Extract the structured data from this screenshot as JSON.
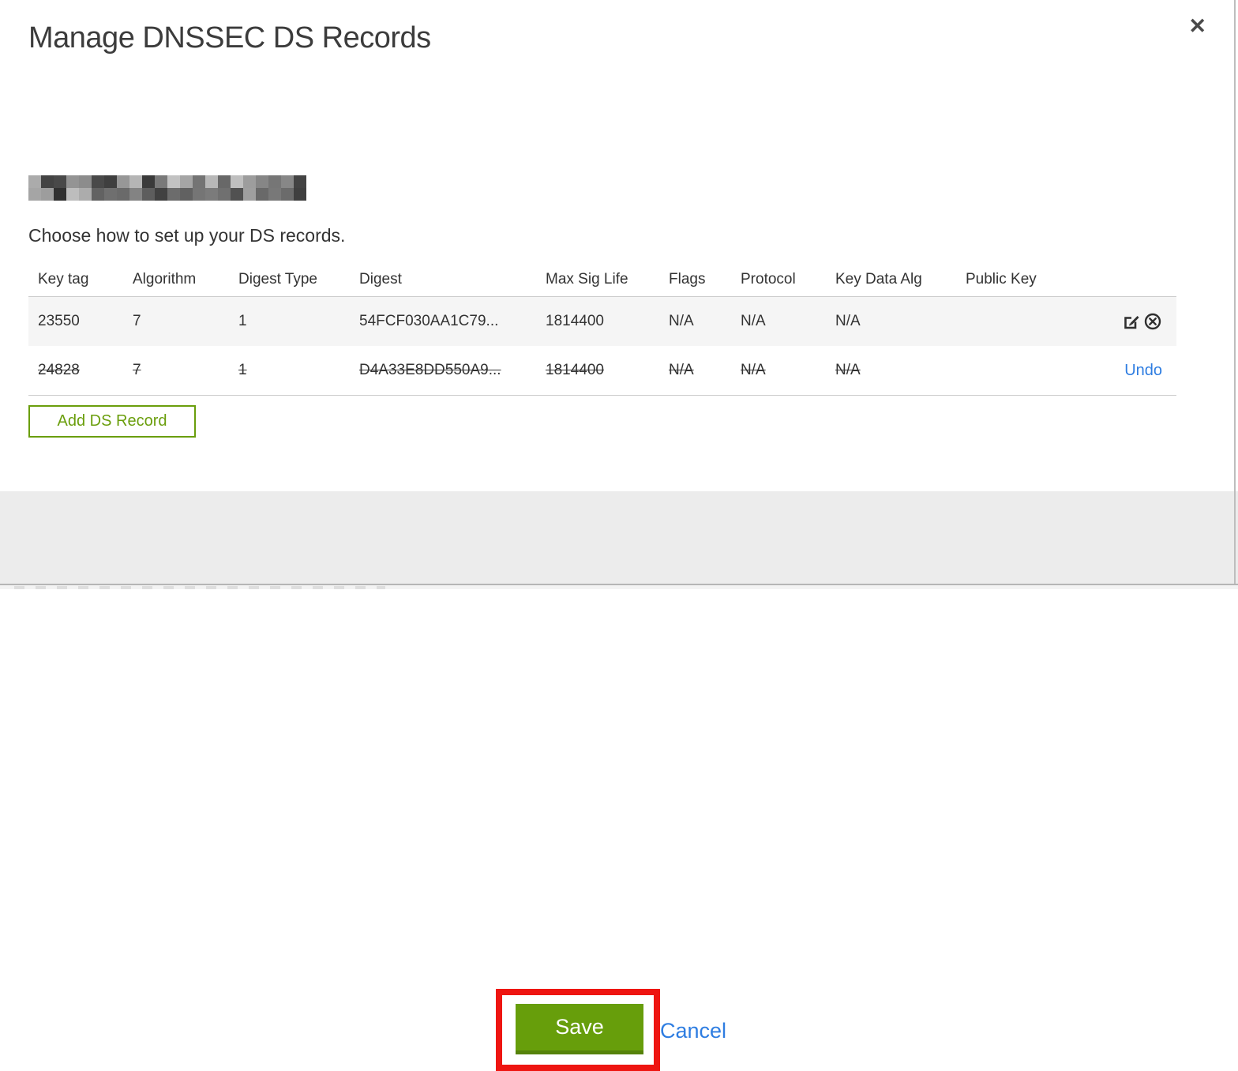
{
  "modal": {
    "title": "Manage DNSSEC DS Records",
    "close_icon": "✕",
    "domain": "(redacted domain name)",
    "subtitle": "Choose how to set up your DS records.",
    "table": {
      "columns": [
        "Key tag",
        "Algorithm",
        "Digest Type",
        "Digest",
        "Max Sig Life",
        "Flags",
        "Protocol",
        "Key Data Alg",
        "Public Key"
      ],
      "rows": [
        {
          "key_tag": "23550",
          "algorithm": "7",
          "digest_type": "1",
          "digest": "54FCF030AA1C79...",
          "max_sig_life": "1814400",
          "flags": "N/A",
          "protocol": "N/A",
          "key_data_alg": "N/A",
          "public_key": "",
          "state": "normal",
          "actions": [
            "edit",
            "delete"
          ]
        },
        {
          "key_tag": "24828",
          "algorithm": "7",
          "digest_type": "1",
          "digest": "D4A33E8DD550A9...",
          "max_sig_life": "1814400",
          "flags": "N/A",
          "protocol": "N/A",
          "key_data_alg": "N/A",
          "public_key": "",
          "state": "deleted",
          "undo_label": "Undo"
        }
      ]
    },
    "add_button_label": "Add DS Record",
    "footer": {
      "save_label": "Save",
      "cancel_label": "Cancel"
    }
  },
  "colors": {
    "accent_green": "#6a9e0c",
    "save_green": "#679e0b",
    "link_blue": "#2e7de1",
    "annotation_red": "#ee1511",
    "row_stripe": "#f5f5f5",
    "footer_bg": "#ececec"
  },
  "annotation": {
    "type": "red-highlight-box",
    "target": "save-button"
  }
}
